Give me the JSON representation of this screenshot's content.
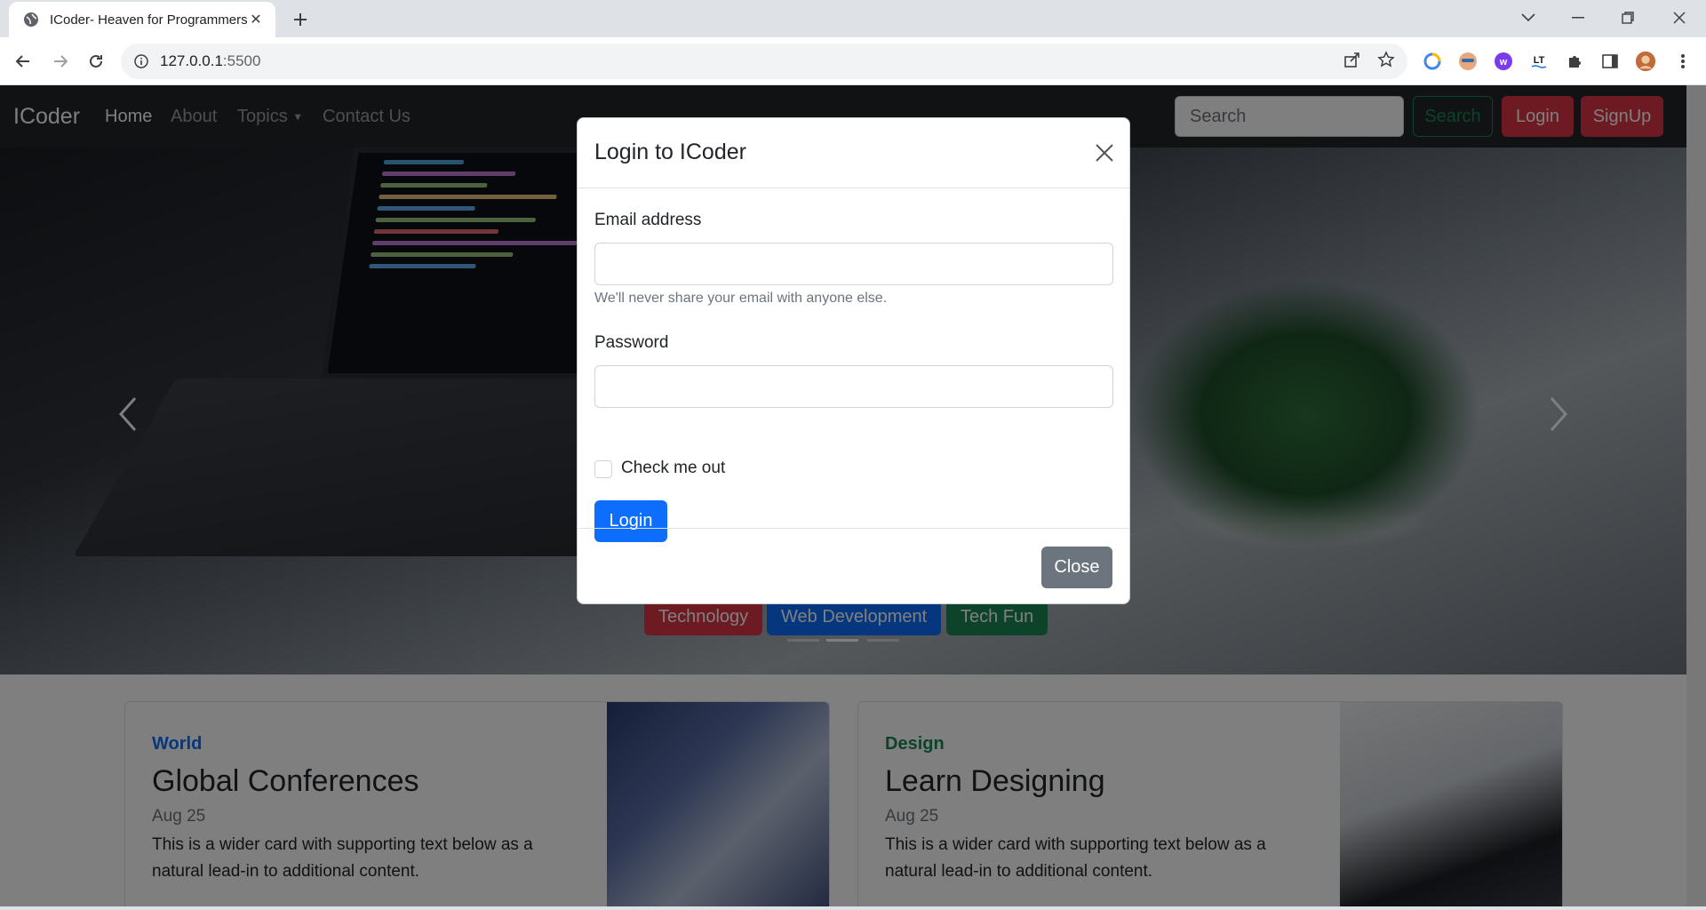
{
  "browser": {
    "tab_title": "ICoder- Heaven for Programmers",
    "url_host": "127.0.0.1",
    "url_port": ":5500"
  },
  "navbar": {
    "brand": "ICoder",
    "links": [
      "Home",
      "About",
      "Topics",
      "Contact Us"
    ],
    "search_placeholder": "Search",
    "search_button": "Search",
    "login_button": "Login",
    "signup_button": "SignUp"
  },
  "hero": {
    "buttons": [
      "Technology",
      "Web Development",
      "Tech Fun"
    ],
    "active_slide": 2,
    "slide_count": 3
  },
  "cards": [
    {
      "category": "World",
      "title": "Global Conferences",
      "date": "Aug 25",
      "text": "This is a wider card with supporting text below as a natural lead-in to additional content."
    },
    {
      "category": "Design",
      "title": "Learn Designing",
      "date": "Aug 25",
      "text": "This is a wider card with supporting text below as a natural lead-in to additional content."
    }
  ],
  "modal": {
    "title": "Login to ICoder",
    "email_label": "Email address",
    "email_help": "We'll never share your email with anyone else.",
    "password_label": "Password",
    "checkbox_label": "Check me out",
    "login_button": "Login",
    "close_button": "Close"
  },
  "colors": {
    "primary": "#0d6efd",
    "danger": "#dc3545",
    "success": "#198754",
    "secondary": "#6c757d",
    "navbar_bg": "#212529"
  }
}
